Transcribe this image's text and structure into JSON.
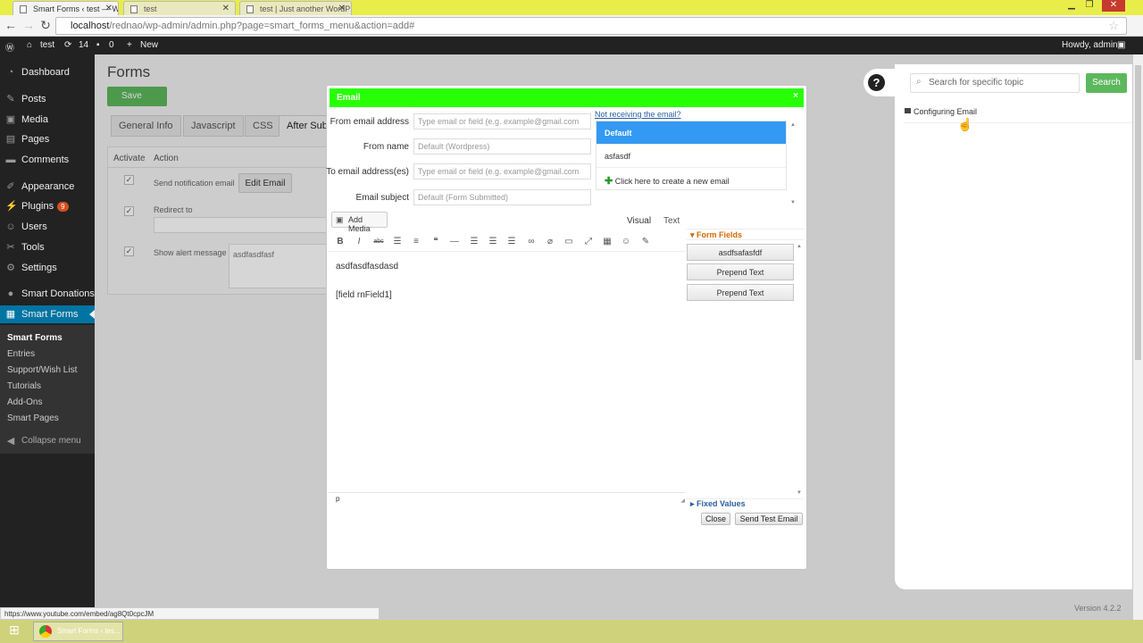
{
  "browser": {
    "tabs": [
      {
        "label": "Smart Forms ‹ test — Wo"
      },
      {
        "label": "test"
      },
      {
        "label": "test | Just another WordP"
      }
    ],
    "url_host": "localhost",
    "url_path": "/rednao/wp-admin/admin.php?page=smart_forms_menu&action=add#",
    "status_url": "https://www.youtube.com/embed/ag8Qt0cpcJM"
  },
  "adminbar": {
    "site": "test",
    "updates": "14",
    "comments": "0",
    "new_label": "New",
    "howdy": "Howdy, admin"
  },
  "sidebar": {
    "items": [
      {
        "label": "Dashboard",
        "icon": "dashboard-icon"
      },
      {
        "label": "Posts",
        "icon": "pin-icon"
      },
      {
        "label": "Media",
        "icon": "media-icon"
      },
      {
        "label": "Pages",
        "icon": "page-icon"
      },
      {
        "label": "Comments",
        "icon": "comment-icon"
      },
      {
        "label": "Appearance",
        "icon": "brush-icon"
      },
      {
        "label": "Plugins",
        "icon": "plug-icon",
        "badge": "9"
      },
      {
        "label": "Users",
        "icon": "user-icon"
      },
      {
        "label": "Tools",
        "icon": "wrench-icon"
      },
      {
        "label": "Settings",
        "icon": "settings-icon"
      },
      {
        "label": "Smart Donations",
        "icon": "donation-icon"
      },
      {
        "label": "Smart Forms",
        "icon": "forms-icon"
      }
    ],
    "submenu": [
      "Smart Forms",
      "Entries",
      "Support/Wish List",
      "Tutorials",
      "Add-Ons",
      "Smart Pages"
    ],
    "collapse": "Collapse menu"
  },
  "main": {
    "title": "Forms",
    "save": "Save",
    "tabs": [
      "General Info",
      "Javascript",
      "CSS",
      "After Sub"
    ],
    "col_activate": "Activate",
    "col_action": "Action",
    "row1": "Send notification email",
    "edit_email": "Edit Email",
    "row2": "Redirect to",
    "row3": "Show alert message",
    "alert_value": "asdfasdfasf",
    "version": "Version 4.2.2"
  },
  "dialog": {
    "title": "Email",
    "close_x": "×",
    "from_email_label": "From email address",
    "from_email_placeholder": "Type email or field (e.g. example@gmail.com",
    "from_name_label": "From name",
    "from_name_placeholder": "Default (Wordpress)",
    "to_label": "To email address(es)",
    "to_placeholder": "Type email or field (e.g. example@gmail.com",
    "subject_label": "Email subject",
    "subject_placeholder": "Default (Form Submitted)",
    "not_receiving": "Not receiving the email?",
    "emails": [
      "Default",
      "asfasdf"
    ],
    "create_email": "Click here to create a new email",
    "add_media": "Add Media",
    "tab_visual": "Visual",
    "tab_text": "Text",
    "body_line1": "asdfasdfasdasd",
    "body_line2": "[field rnField1]",
    "path": "p",
    "form_fields_header": "Form Fields",
    "fields": [
      "asdfsafasfdf",
      "Prepend Text",
      "Prepend Text"
    ],
    "fixed_values": "Fixed Values",
    "close_btn": "Close",
    "send_test_btn": "Send Test Email"
  },
  "help": {
    "search_placeholder": "Search for specific topic",
    "search_btn": "Search",
    "topic": "Configuring Email"
  },
  "taskbar": {
    "task": "Smart Forms ‹ tes..."
  },
  "colors": {
    "dialog_title": "#27ff05",
    "admin_bar": "#222222",
    "active_menu": "#0074a2",
    "selected_email": "#3399f3",
    "search_button": "#5cb85c"
  }
}
